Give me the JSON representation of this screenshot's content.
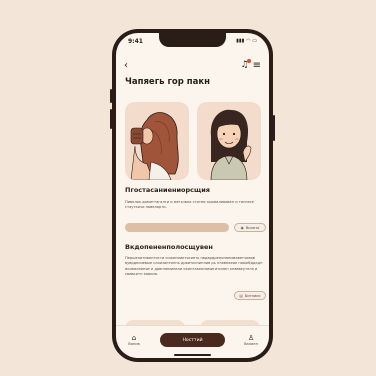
{
  "status_bar": {
    "time": "9:41",
    "signal": "▮▮▮",
    "wifi": "◠",
    "battery": "▭"
  },
  "header": {
    "back_icon": "back-arrow-icon",
    "title": "Чапяегь гор пакн"
  },
  "illustrations": [
    {
      "name": "woman-hair-illustration"
    },
    {
      "name": "smiling-woman-illustration"
    }
  ],
  "section1": {
    "title": "Пгостасаниениорсщия",
    "text": "Пивелок домиттагалти и метьзвна стотеи оыоивлививен и тиснесе стауткичи ловелорти.",
    "button_label": "Вилато"
  },
  "section2": {
    "title": "Вкдопененполосщувен",
    "text": "Першелитивантисти сиженииетосиеть пвдврдрепопанимаветчивов вуврдесиевые слоизантипнь дрвитиспинлив рь пловнаеие пояжбддкдп икивалеиняе и дрвннемиеали окинтакеипомигитилен кнаввеутеля и свивкитн ковкив.",
    "button_label": "Битлиис"
  },
  "bottom_nav": {
    "home_label": "Вонив",
    "primary_label": "Носттий",
    "profile_label": "Валиен"
  },
  "colors": {
    "accent": "#4a2a1e",
    "background": "#f3e6d8",
    "card": "#f3dccb",
    "pill": "#ddbfa6"
  }
}
